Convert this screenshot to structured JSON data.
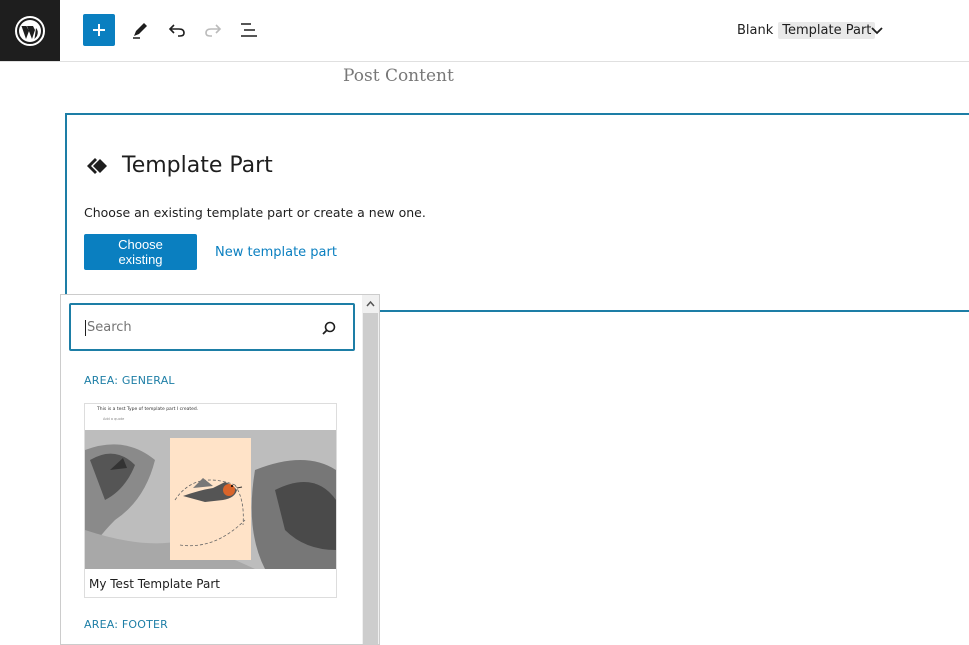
{
  "toolbar": {
    "add_icon": "plus-icon",
    "tools_icon": "pencil-icon",
    "undo_icon": "undo-icon",
    "redo_icon": "redo-icon",
    "list_view_icon": "list-view-icon",
    "document_title": "Blank",
    "document_type": "Template Part",
    "accent_color": "#0a7fc0"
  },
  "canvas": {
    "post_content": "Post Content"
  },
  "template_part": {
    "title": "Template Part",
    "instructions": "Choose an existing template part or create a new one.",
    "choose_existing_label": "Choose existing",
    "new_template_part_label": "New template part"
  },
  "popover": {
    "search_placeholder": "Search",
    "areas": [
      {
        "label": "AREA: GENERAL",
        "items": [
          {
            "label": "My Test Template Part",
            "preview_text": "This is a test Type of template part I created.",
            "preview_subtext": "Add a quote"
          }
        ]
      },
      {
        "label": "AREA: FOOTER",
        "items": []
      }
    ]
  }
}
